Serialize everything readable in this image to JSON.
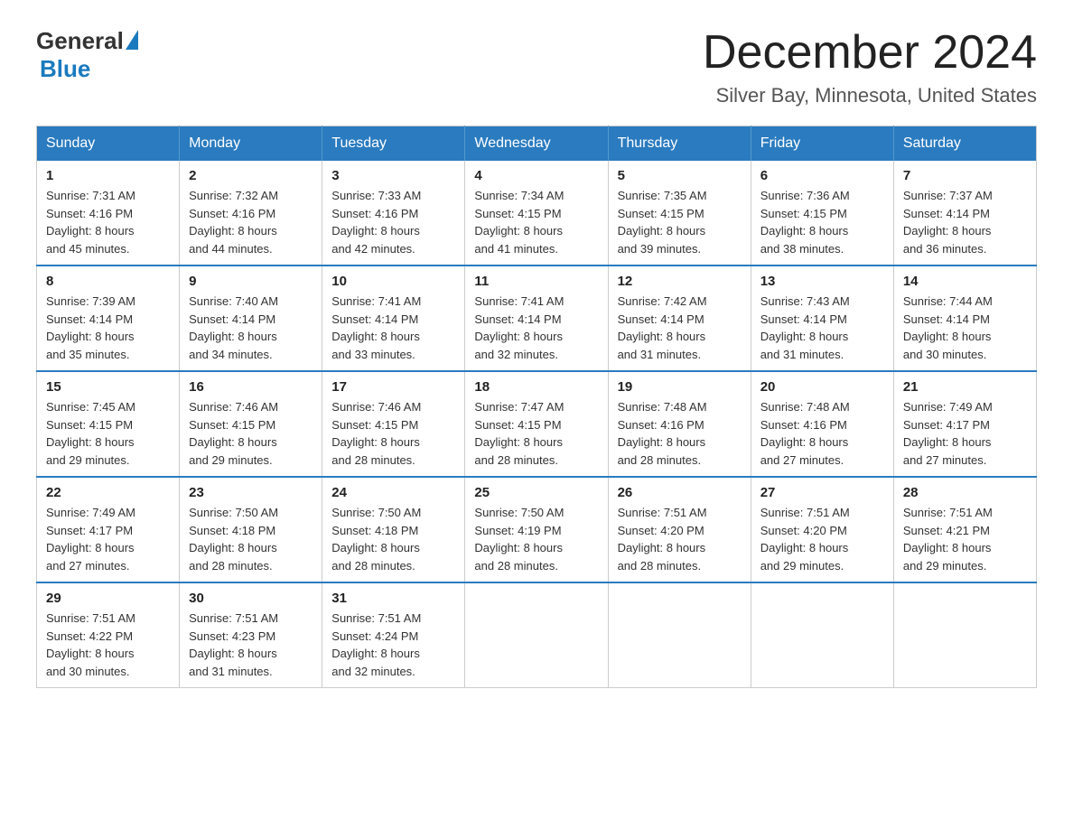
{
  "logo": {
    "general": "General",
    "blue": "Blue"
  },
  "header": {
    "month": "December 2024",
    "location": "Silver Bay, Minnesota, United States"
  },
  "weekdays": [
    "Sunday",
    "Monday",
    "Tuesday",
    "Wednesday",
    "Thursday",
    "Friday",
    "Saturday"
  ],
  "weeks": [
    [
      {
        "day": "1",
        "sunrise": "7:31 AM",
        "sunset": "4:16 PM",
        "daylight": "8 hours and 45 minutes."
      },
      {
        "day": "2",
        "sunrise": "7:32 AM",
        "sunset": "4:16 PM",
        "daylight": "8 hours and 44 minutes."
      },
      {
        "day": "3",
        "sunrise": "7:33 AM",
        "sunset": "4:16 PM",
        "daylight": "8 hours and 42 minutes."
      },
      {
        "day": "4",
        "sunrise": "7:34 AM",
        "sunset": "4:15 PM",
        "daylight": "8 hours and 41 minutes."
      },
      {
        "day": "5",
        "sunrise": "7:35 AM",
        "sunset": "4:15 PM",
        "daylight": "8 hours and 39 minutes."
      },
      {
        "day": "6",
        "sunrise": "7:36 AM",
        "sunset": "4:15 PM",
        "daylight": "8 hours and 38 minutes."
      },
      {
        "day": "7",
        "sunrise": "7:37 AM",
        "sunset": "4:14 PM",
        "daylight": "8 hours and 36 minutes."
      }
    ],
    [
      {
        "day": "8",
        "sunrise": "7:39 AM",
        "sunset": "4:14 PM",
        "daylight": "8 hours and 35 minutes."
      },
      {
        "day": "9",
        "sunrise": "7:40 AM",
        "sunset": "4:14 PM",
        "daylight": "8 hours and 34 minutes."
      },
      {
        "day": "10",
        "sunrise": "7:41 AM",
        "sunset": "4:14 PM",
        "daylight": "8 hours and 33 minutes."
      },
      {
        "day": "11",
        "sunrise": "7:41 AM",
        "sunset": "4:14 PM",
        "daylight": "8 hours and 32 minutes."
      },
      {
        "day": "12",
        "sunrise": "7:42 AM",
        "sunset": "4:14 PM",
        "daylight": "8 hours and 31 minutes."
      },
      {
        "day": "13",
        "sunrise": "7:43 AM",
        "sunset": "4:14 PM",
        "daylight": "8 hours and 31 minutes."
      },
      {
        "day": "14",
        "sunrise": "7:44 AM",
        "sunset": "4:14 PM",
        "daylight": "8 hours and 30 minutes."
      }
    ],
    [
      {
        "day": "15",
        "sunrise": "7:45 AM",
        "sunset": "4:15 PM",
        "daylight": "8 hours and 29 minutes."
      },
      {
        "day": "16",
        "sunrise": "7:46 AM",
        "sunset": "4:15 PM",
        "daylight": "8 hours and 29 minutes."
      },
      {
        "day": "17",
        "sunrise": "7:46 AM",
        "sunset": "4:15 PM",
        "daylight": "8 hours and 28 minutes."
      },
      {
        "day": "18",
        "sunrise": "7:47 AM",
        "sunset": "4:15 PM",
        "daylight": "8 hours and 28 minutes."
      },
      {
        "day": "19",
        "sunrise": "7:48 AM",
        "sunset": "4:16 PM",
        "daylight": "8 hours and 28 minutes."
      },
      {
        "day": "20",
        "sunrise": "7:48 AM",
        "sunset": "4:16 PM",
        "daylight": "8 hours and 27 minutes."
      },
      {
        "day": "21",
        "sunrise": "7:49 AM",
        "sunset": "4:17 PM",
        "daylight": "8 hours and 27 minutes."
      }
    ],
    [
      {
        "day": "22",
        "sunrise": "7:49 AM",
        "sunset": "4:17 PM",
        "daylight": "8 hours and 27 minutes."
      },
      {
        "day": "23",
        "sunrise": "7:50 AM",
        "sunset": "4:18 PM",
        "daylight": "8 hours and 28 minutes."
      },
      {
        "day": "24",
        "sunrise": "7:50 AM",
        "sunset": "4:18 PM",
        "daylight": "8 hours and 28 minutes."
      },
      {
        "day": "25",
        "sunrise": "7:50 AM",
        "sunset": "4:19 PM",
        "daylight": "8 hours and 28 minutes."
      },
      {
        "day": "26",
        "sunrise": "7:51 AM",
        "sunset": "4:20 PM",
        "daylight": "8 hours and 28 minutes."
      },
      {
        "day": "27",
        "sunrise": "7:51 AM",
        "sunset": "4:20 PM",
        "daylight": "8 hours and 29 minutes."
      },
      {
        "day": "28",
        "sunrise": "7:51 AM",
        "sunset": "4:21 PM",
        "daylight": "8 hours and 29 minutes."
      }
    ],
    [
      {
        "day": "29",
        "sunrise": "7:51 AM",
        "sunset": "4:22 PM",
        "daylight": "8 hours and 30 minutes."
      },
      {
        "day": "30",
        "sunrise": "7:51 AM",
        "sunset": "4:23 PM",
        "daylight": "8 hours and 31 minutes."
      },
      {
        "day": "31",
        "sunrise": "7:51 AM",
        "sunset": "4:24 PM",
        "daylight": "8 hours and 32 minutes."
      },
      null,
      null,
      null,
      null
    ]
  ],
  "labels": {
    "sunrise": "Sunrise:",
    "sunset": "Sunset:",
    "daylight": "Daylight:"
  }
}
